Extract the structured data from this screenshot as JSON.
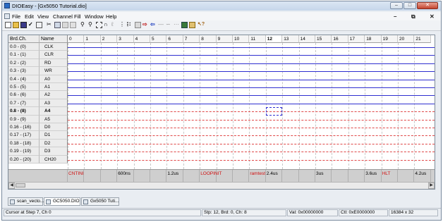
{
  "window": {
    "title": "DIOEasy - [Gx5050 Tutorial.dio]"
  },
  "menu": {
    "items": [
      "File",
      "Edit",
      "View",
      "Channel",
      "Fill",
      "Window",
      "Help"
    ]
  },
  "grid": {
    "col_headers": {
      "brd_ch": "Brd.Ch.",
      "name": "Name"
    },
    "steps": [
      "0",
      "1",
      "2",
      "3",
      "4",
      "5",
      "6",
      "7",
      "8",
      "9",
      "10",
      "11",
      "12",
      "13",
      "14",
      "15",
      "16",
      "17",
      "18",
      "19",
      "20",
      "21"
    ],
    "selected_step": "12",
    "rows": [
      {
        "brd": "0.0  -  (0)",
        "name": "CLK",
        "style": "solid"
      },
      {
        "brd": "0.1  -  (1)",
        "name": "CLR",
        "style": "solid"
      },
      {
        "brd": "0.2  -  (2)",
        "name": "RD",
        "style": "solid"
      },
      {
        "brd": "0.3  -  (3)",
        "name": "WR",
        "style": "solid"
      },
      {
        "brd": "0.4  -  (4)",
        "name": "A0",
        "style": "solid"
      },
      {
        "brd": "0.5  -  (5)",
        "name": "A1",
        "style": "solid"
      },
      {
        "brd": "0.6  -  (6)",
        "name": "A2",
        "style": "solid"
      },
      {
        "brd": "0.7  -  (7)",
        "name": "A3",
        "style": "solid"
      },
      {
        "brd": "0.8  -  (8)",
        "name": "A4",
        "style": "dash",
        "selected": true
      },
      {
        "brd": "0.9  -  (9)",
        "name": "A5",
        "style": "dash"
      },
      {
        "brd": "0.16  -  (16)",
        "name": "D0",
        "style": "dash"
      },
      {
        "brd": "0.17  -  (17)",
        "name": "D1",
        "style": "dash"
      },
      {
        "brd": "0.18  -  (18)",
        "name": "D2",
        "style": "dash"
      },
      {
        "brd": "0.19  -  (19)",
        "name": "D3",
        "style": "dash"
      },
      {
        "brd": "0.20  -  (20)",
        "name": "CH20",
        "style": "dash"
      }
    ],
    "annotations": [
      {
        "step": 0,
        "text": "CNTINI",
        "color": "#d01010"
      },
      {
        "step": 3,
        "text": "600ns",
        "color": "#000000"
      },
      {
        "step": 6,
        "text": "1.2us",
        "color": "#000000"
      },
      {
        "step": 8,
        "text": "LOOPINIT",
        "color": "#d01010"
      },
      {
        "step": 11,
        "text": "ramtest",
        "color": "#d01010"
      },
      {
        "step": 12,
        "text": "2.4us",
        "color": "#000000"
      },
      {
        "step": 15,
        "text": "3us",
        "color": "#000000"
      },
      {
        "step": 18,
        "text": "3.6us",
        "color": "#000000"
      },
      {
        "step": 19,
        "text": "HLT",
        "color": "#d01010"
      },
      {
        "step": 21,
        "text": "4.2us",
        "color": "#000000"
      }
    ]
  },
  "tabs": [
    {
      "label": "scan_vecto...",
      "active": false
    },
    {
      "label": "GC5050.DIO",
      "active": true
    },
    {
      "label": "Gx5050 Tuti...",
      "active": false
    }
  ],
  "status": {
    "cursor": "Cursor at Step 7, Ch 0",
    "step": "Stp: 12, Brd: 0, Ch: 8",
    "val": "Val: 0x00000000",
    "ctl": "Ctl: 0xE0000000",
    "size": "16384 x 32"
  },
  "colors": {
    "signal_solid": "#2f2fd0",
    "signal_dash": "#e04848",
    "annotation_red": "#d01010"
  }
}
